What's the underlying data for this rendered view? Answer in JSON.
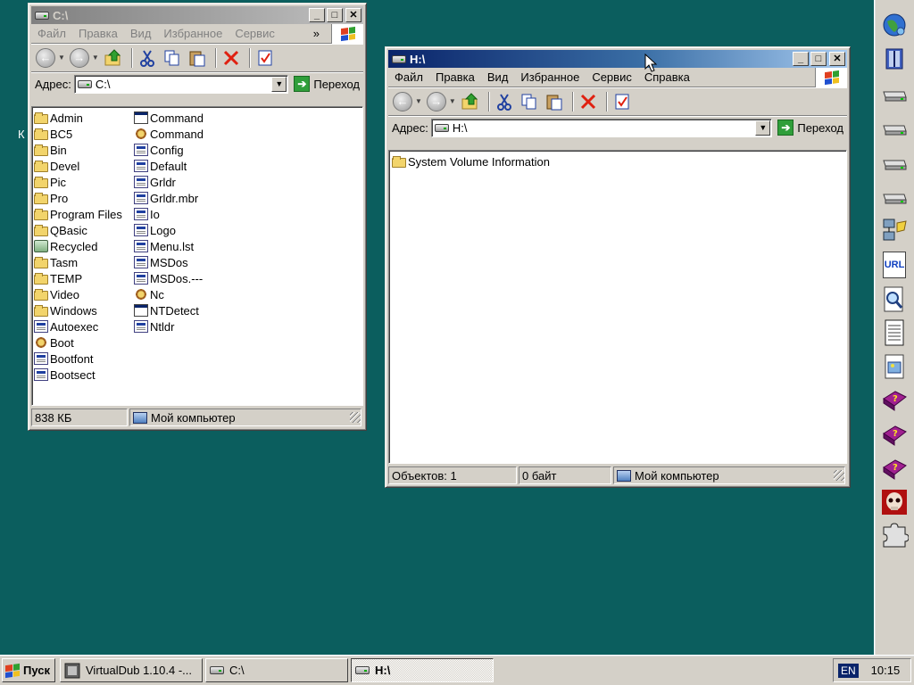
{
  "desktop": {
    "partial_label": "К"
  },
  "window_c": {
    "title": "C:\\",
    "menu": [
      "Файл",
      "Правка",
      "Вид",
      "Избранное",
      "Сервис"
    ],
    "menu_more": "»",
    "address_label": "Адрес:",
    "address_value": "C:\\",
    "go_label": "Переход",
    "files_col1": [
      {
        "name": "Admin",
        "icon": "folder-icon"
      },
      {
        "name": "BC5",
        "icon": "folder-icon"
      },
      {
        "name": "Bin",
        "icon": "folder-icon"
      },
      {
        "name": "Devel",
        "icon": "folder-icon"
      },
      {
        "name": "Pic",
        "icon": "folder-icon"
      },
      {
        "name": "Pro",
        "icon": "folder-icon"
      },
      {
        "name": "Program Files",
        "icon": "folder-icon"
      },
      {
        "name": "QBasic",
        "icon": "folder-icon"
      },
      {
        "name": "Recycled",
        "icon": "recycle-bin-icon"
      },
      {
        "name": "Tasm",
        "icon": "folder-icon"
      },
      {
        "name": "TEMP",
        "icon": "folder-icon"
      },
      {
        "name": "Video",
        "icon": "folder-icon"
      },
      {
        "name": "Windows",
        "icon": "folder-icon"
      },
      {
        "name": "Autoexec",
        "icon": "system-file-icon"
      },
      {
        "name": "Boot",
        "icon": "settings-file-icon"
      },
      {
        "name": "Bootfont",
        "icon": "system-file-icon"
      },
      {
        "name": "Bootsect",
        "icon": "system-file-icon"
      }
    ],
    "files_col2": [
      {
        "name": "Command",
        "icon": "app-icon"
      },
      {
        "name": "Command",
        "icon": "msdos-icon"
      },
      {
        "name": "Config",
        "icon": "system-file-icon"
      },
      {
        "name": "Default",
        "icon": "system-file-icon"
      },
      {
        "name": "Grldr",
        "icon": "system-file-icon"
      },
      {
        "name": "Grldr.mbr",
        "icon": "system-file-icon"
      },
      {
        "name": "Io",
        "icon": "system-file-icon"
      },
      {
        "name": "Logo",
        "icon": "system-file-icon"
      },
      {
        "name": "Menu.lst",
        "icon": "system-file-icon"
      },
      {
        "name": "MSDos",
        "icon": "system-file-icon"
      },
      {
        "name": "MSDos.---",
        "icon": "system-file-icon"
      },
      {
        "name": "Nc",
        "icon": "settings-file-icon"
      },
      {
        "name": "NTDetect",
        "icon": "app-icon"
      },
      {
        "name": "Ntldr",
        "icon": "system-file-icon"
      }
    ],
    "status_size": "838 КБ",
    "status_location": "Мой компьютер"
  },
  "window_h": {
    "title": "H:\\",
    "menu": [
      "Файл",
      "Правка",
      "Вид",
      "Избранное",
      "Сервис",
      "Справка"
    ],
    "address_label": "Адрес:",
    "address_value": "H:\\",
    "go_label": "Переход",
    "files": [
      {
        "name": "System Volume Information",
        "icon": "folder-icon"
      }
    ],
    "status_objects": "Объектов: 1",
    "status_size": "0 байт",
    "status_location": "Мой компьютер"
  },
  "sidebar": {
    "icons": [
      "globe-icon",
      "archive-icon",
      "drive-icon",
      "drive-icon",
      "drive-icon",
      "drive-icon",
      "network-icon",
      "url-icon",
      "search-icon",
      "notepad-icon",
      "image-doc-icon",
      "help-book-icon",
      "help-book-icon",
      "help-book-icon",
      "skull-game-icon",
      "puzzle-icon"
    ],
    "url_text": "URL"
  },
  "taskbar": {
    "start_label": "Пуск",
    "tasks": [
      {
        "label": "VirtualDub 1.10.4 -...",
        "icon": "virtualdub-icon"
      },
      {
        "label": "C:\\",
        "icon": "drive-icon"
      },
      {
        "label": "H:\\",
        "icon": "drive-icon"
      }
    ],
    "language": "EN",
    "clock": "10:15"
  }
}
